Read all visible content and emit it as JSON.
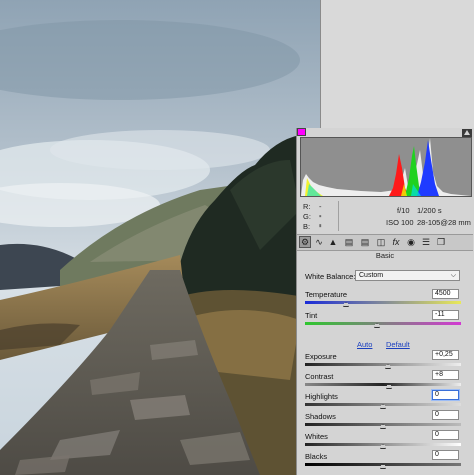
{
  "colors": {
    "panel_bg": "#d4d4d4",
    "histogram_bg": "#8f8f8f",
    "shadow_clip": "#ff00ff",
    "link": "#1a3fbf"
  },
  "readout": {
    "r_label": "R:",
    "g_label": "G:",
    "b_label": "B:",
    "r_value": "---",
    "g_value": "---",
    "b_value": "---",
    "aperture": "f/10",
    "shutter": "1/200 s",
    "iso": "ISO 100",
    "lens": "28-105@28 mm"
  },
  "toolbar": {
    "tools": [
      "basic-icon",
      "tone-curve-icon",
      "detail-icon",
      "hsl-icon",
      "split-toning-icon",
      "lens-corrections-icon",
      "effects-icon",
      "camera-calibration-icon",
      "presets-icon",
      "snapshots-icon"
    ]
  },
  "panel": {
    "section_title": "Basic",
    "white_balance_label": "White Balance:",
    "white_balance_value": "Custom",
    "auto_label": "Auto",
    "default_label": "Default"
  },
  "sliders": {
    "temperature": {
      "label": "Temperature",
      "value": "4500",
      "level": 0.26
    },
    "tint": {
      "label": "Tint",
      "value": "-11",
      "level": 0.46
    },
    "exposure": {
      "label": "Exposure",
      "value": "+0,25",
      "level": 0.53
    },
    "contrast": {
      "label": "Contrast",
      "value": "+8",
      "level": 0.54
    },
    "highlights": {
      "label": "Highlights",
      "value": "0",
      "level": 0.5
    },
    "shadows": {
      "label": "Shadows",
      "value": "0",
      "level": 0.5
    },
    "whites": {
      "label": "Whites",
      "value": "0",
      "level": 0.5
    },
    "blacks": {
      "label": "Blacks",
      "value": "0",
      "level": 0.5
    }
  }
}
